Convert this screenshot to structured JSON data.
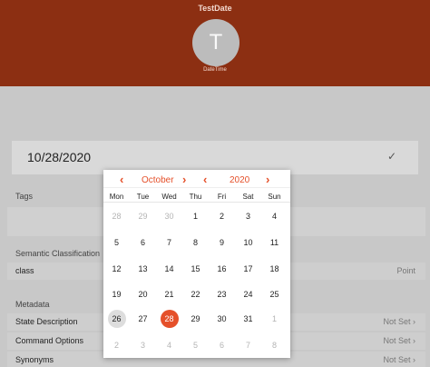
{
  "header": {
    "title": "TestDate",
    "avatar_letter": "T",
    "avatar_caption": "DateTime"
  },
  "date_field": {
    "value": "10/28/2020"
  },
  "sections": {
    "tags": "Tags",
    "semantic": "Semantic Classification",
    "metadata": "Metadata"
  },
  "semantic_row": {
    "label": "class",
    "value": "Point"
  },
  "metadata_rows": [
    {
      "label": "State Description",
      "value": "Not Set ›"
    },
    {
      "label": "Command Options",
      "value": "Not Set ›"
    },
    {
      "label": "Synonyms",
      "value": "Not Set ›"
    }
  ],
  "calendar": {
    "month": "October",
    "year": "2020",
    "prev": "‹",
    "next": "›",
    "weekdays": [
      "Mon",
      "Tue",
      "Wed",
      "Thu",
      "Fri",
      "Sat",
      "Sun"
    ],
    "weeks": [
      [
        "28",
        "29",
        "30",
        "1",
        "2",
        "3",
        "4"
      ],
      [
        "5",
        "6",
        "7",
        "8",
        "9",
        "10",
        "11"
      ],
      [
        "12",
        "13",
        "14",
        "15",
        "16",
        "17",
        "18"
      ],
      [
        "19",
        "20",
        "21",
        "22",
        "23",
        "24",
        "25"
      ],
      [
        "26",
        "27",
        "28",
        "29",
        "30",
        "31",
        "1"
      ],
      [
        "2",
        "3",
        "4",
        "5",
        "6",
        "7",
        "8"
      ]
    ],
    "today": "26",
    "selected": "28"
  },
  "colors": {
    "header": "#8c2f12",
    "accent": "#e5502a"
  }
}
